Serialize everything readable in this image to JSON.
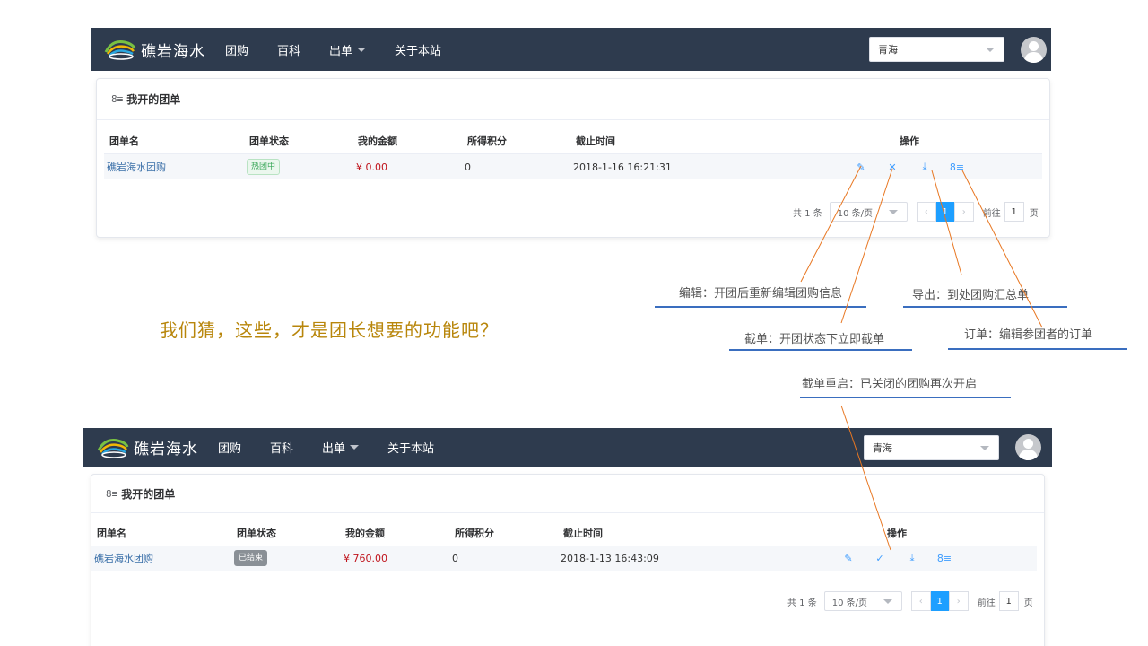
{
  "app": {
    "logo_text": "礁岩海水",
    "nav": [
      "团购",
      "百科",
      "出单",
      "关于本站"
    ],
    "region": "青海"
  },
  "card_title": "我开的团单",
  "columns": [
    "团单名",
    "团单状态",
    "我的金额",
    "所得积分",
    "截止时间",
    "操作"
  ],
  "screen1": {
    "row": {
      "name": "礁岩海水团购",
      "status": "热团中",
      "amount": "¥ 0.00",
      "points": "0",
      "deadline": "2018-1-16 16:21:31"
    }
  },
  "screen2": {
    "row": {
      "name": "礁岩海水团购",
      "status": "已结束",
      "amount": "¥ 760.00",
      "points": "0",
      "deadline": "2018-1-13 16:43:09"
    }
  },
  "pager": {
    "total": "共 1 条",
    "page_size": "10 条/页",
    "current": "1",
    "goto_label": "前往",
    "goto_value": "1",
    "page_unit": "页"
  },
  "annotations": {
    "edit": "编辑：开团后重新编辑团购信息",
    "export": "导出：到处团购汇总单",
    "close": "截单：开团状态下立即截单",
    "orders": "订单：编辑参团者的订单",
    "reopen": "截单重启：已关闭的团购再次开启"
  },
  "tagline": "我们猜，这些，才是团长想要的功能吧？",
  "colors": {
    "navbar": "#2e3b4e",
    "primary": "#1e9fff",
    "money": "#c0141c",
    "annotation_line": "#e87722",
    "underline": "#3a6ebf",
    "tagline": "#b8860b"
  }
}
